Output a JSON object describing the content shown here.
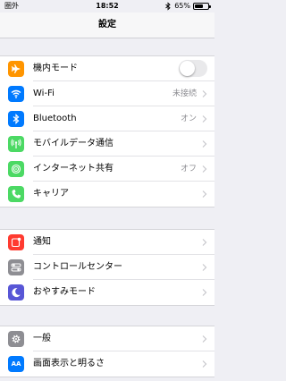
{
  "status_bar": {
    "carrier": "圏外",
    "time": "18:52",
    "battery_percent": "65%",
    "battery_level": 0.65
  },
  "nav": {
    "title": "設定"
  },
  "groups": [
    {
      "items": [
        {
          "label": "機内モード",
          "value": "",
          "icon": "airplane-icon",
          "color": "#ff9500",
          "toggle_on": false
        },
        {
          "label": "Wi-Fi",
          "value": "未接続",
          "icon": "wifi-icon",
          "color": "#007aff"
        },
        {
          "label": "Bluetooth",
          "value": "オン",
          "icon": "bluetooth-icon",
          "color": "#007aff"
        },
        {
          "label": "モバイルデータ通信",
          "value": "",
          "icon": "antenna-icon",
          "color": "#4cd964"
        },
        {
          "label": "インターネット共有",
          "value": "オフ",
          "icon": "hotspot-icon",
          "color": "#4cd964"
        },
        {
          "label": "キャリア",
          "value": "",
          "icon": "phone-icon",
          "color": "#4cd964"
        }
      ]
    },
    {
      "items": [
        {
          "label": "通知",
          "value": "",
          "icon": "notifications-icon",
          "color": "#ff3b30"
        },
        {
          "label": "コントロールセンター",
          "value": "",
          "icon": "control-center-icon",
          "color": "#8e8e93"
        },
        {
          "label": "おやすみモード",
          "value": "",
          "icon": "moon-icon",
          "color": "#5856d6"
        }
      ]
    },
    {
      "items": [
        {
          "label": "一般",
          "value": "",
          "icon": "gear-icon",
          "color": "#8e8e93"
        },
        {
          "label": "画面表示と明るさ",
          "value": "",
          "icon": "display-brightness-icon",
          "color": "#007aff"
        }
      ]
    }
  ]
}
